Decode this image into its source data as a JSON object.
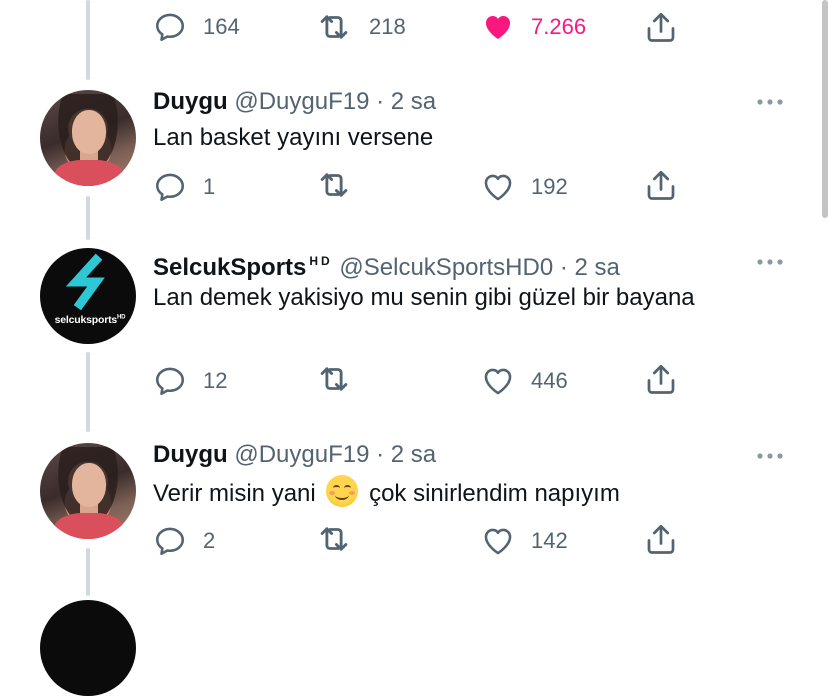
{
  "colors": {
    "text": "#0f1419",
    "muted": "#536471",
    "like_active": "#f91880",
    "thread_line": "#cfd9de",
    "logo_accent": "#2ec7d6"
  },
  "top_actions": {
    "replies": "164",
    "retweets": "218",
    "likes": "7.266",
    "liked": true
  },
  "tweets": [
    {
      "name": "Duygu",
      "handle": "@DuyguF19",
      "separator": "·",
      "time": "2 sa",
      "text": "Lan basket yayını versene",
      "replies": "1",
      "likes": "192",
      "avatar_icon": "profile-photo-icon"
    },
    {
      "name": "SelcukSports",
      "name_badge": "HD",
      "handle": "@SelcukSportsHD0",
      "separator": "·",
      "time": "2 sa",
      "text": "Lan demek yakisiyo mu senin gibi güzel bir bayana",
      "replies": "12",
      "likes": "446",
      "avatar_text": "selcuksports",
      "avatar_badge": "HD",
      "avatar_icon": "selcuksports-logo-icon"
    },
    {
      "name": "Duygu",
      "handle": "@DuyguF19",
      "separator": "·",
      "time": "2 sa",
      "text_before_emoji": "Verir misin yani",
      "emoji_icon": "smiling-face-emoji",
      "text_after_emoji": "çok sinirlendim napıyım",
      "replies": "2",
      "likes": "142",
      "avatar_icon": "profile-photo-icon"
    }
  ]
}
